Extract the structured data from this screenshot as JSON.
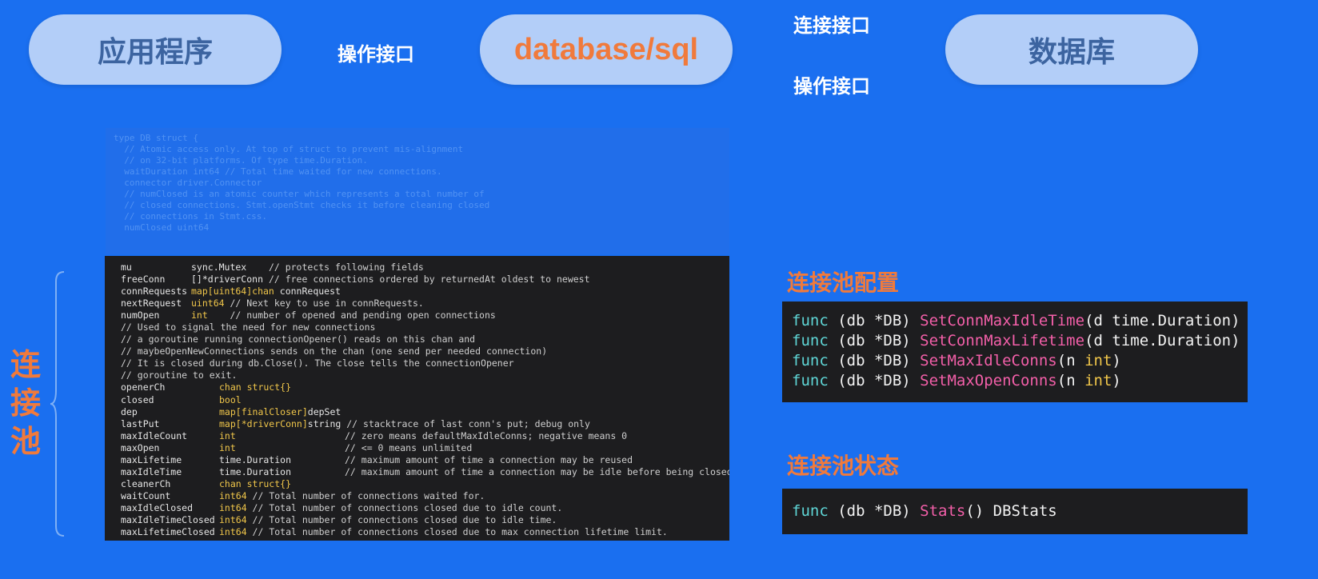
{
  "diagram": {
    "app_label": "应用程序",
    "sql_label": "database/sql",
    "db_label": "数据库",
    "op_interface_left": "操作接口",
    "conn_interface_right": "连接接口",
    "op_interface_right": "操作接口"
  },
  "pool": {
    "label": "连接池"
  },
  "ghost_code": [
    "type DB struct {",
    "  // Atomic access only. At top of struct to prevent mis-alignment",
    "  // on 32-bit platforms. Of type time.Duration.",
    "  waitDuration int64 // Total time waited for new connections.",
    "",
    "  connector driver.Connector",
    "  // numClosed is an atomic counter which represents a total number of",
    "  // closed connections. Stmt.openStmt checks it before cleaning closed",
    "  // connections in Stmt.css.",
    "  numClosed uint64"
  ],
  "code": {
    "l1_name": "mu",
    "l1_type": "sync.Mutex",
    "l1_comment": "    // protects following fields",
    "l2_name": "freeConn",
    "l2_type": "[]*driverConn",
    "l2_comment": " // free connections ordered by returnedAt oldest to newest",
    "l3_name": "connRequests",
    "l3_kw": "map[uint64]chan",
    "l3_rest": " connRequest",
    "l4_name": "nextRequest",
    "l4_kw": "uint64",
    "l4_comment": " // Next key to use in connRequests.",
    "l5_name": "numOpen",
    "l5_kw": "int",
    "l5_comment": "    // number of opened and pending open connections",
    "l6": "// Used to signal the need for new connections",
    "l7": "// a goroutine running connectionOpener() reads on this chan and",
    "l8": "// maybeOpenNewConnections sends on the chan (one send per needed connection)",
    "l9": "// It is closed during db.Close(). The close tells the connectionOpener",
    "l10": "// goroutine to exit.",
    "l11_name": "openerCh",
    "l11_kw": "chan struct{}",
    "l12_name": "closed",
    "l12_kw": "bool",
    "l13_name": "dep",
    "l13_kw": "map[finalCloser]",
    "l13_rest": "depSet",
    "l14_name": "lastPut",
    "l14_kw": "map[*driverConn]",
    "l14_rest": "string",
    "l14_comment": " // stacktrace of last conn's put; debug only",
    "l15_name": "maxIdleCount",
    "l15_kw": "int",
    "l15_comment": "// zero means defaultMaxIdleConns; negative means 0",
    "l16_name": "maxOpen",
    "l16_kw": "int",
    "l16_comment": "// <= 0 means unlimited",
    "l17_name": "maxLifetime",
    "l17_type": "time.Duration",
    "l17_comment": "// maximum amount of time a connection may be reused",
    "l18_name": "maxIdleTime",
    "l18_type": "time.Duration",
    "l18_comment": "// maximum amount of time a connection may be idle before being closed",
    "l19_name": "cleanerCh",
    "l19_kw": "chan struct{}",
    "l20_name": "waitCount",
    "l20_kw": "int64",
    "l20_comment": " // Total number of connections waited for.",
    "l21_name": "maxIdleClosed",
    "l21_kw": "int64",
    "l21_comment": " // Total number of connections closed due to idle count.",
    "l22_name": "maxIdleTimeClosed",
    "l22_kw": "int64",
    "l22_comment": " // Total number of connections closed due to idle time.",
    "l23_name": "maxLifetimeClosed",
    "l23_kw": "int64",
    "l23_comment": " // Total number of connections closed due to max connection lifetime limit."
  },
  "config": {
    "title": "连接池配置",
    "f1_kw": "func",
    "f1_recv": " (db *DB) ",
    "f1_name": "SetConnMaxIdleTime",
    "f1_args": "(d time.Duration)",
    "f2_kw": "func",
    "f2_recv": " (db *DB) ",
    "f2_name": "SetConnMaxLifetime",
    "f2_args": "(d time.Duration)",
    "f3_kw": "func",
    "f3_recv": " (db *DB) ",
    "f3_name": "SetMaxIdleConns",
    "f3_open": "(n ",
    "f3_type": "int",
    "f3_close": ")",
    "f4_kw": "func",
    "f4_recv": " (db *DB) ",
    "f4_name": "SetMaxOpenConns",
    "f4_open": "(n ",
    "f4_type": "int",
    "f4_close": ")"
  },
  "status": {
    "title": "连接池状态",
    "s1_kw": "func",
    "s1_recv": " (db *DB) ",
    "s1_name": "Stats",
    "s1_rest": "() DBStats"
  }
}
